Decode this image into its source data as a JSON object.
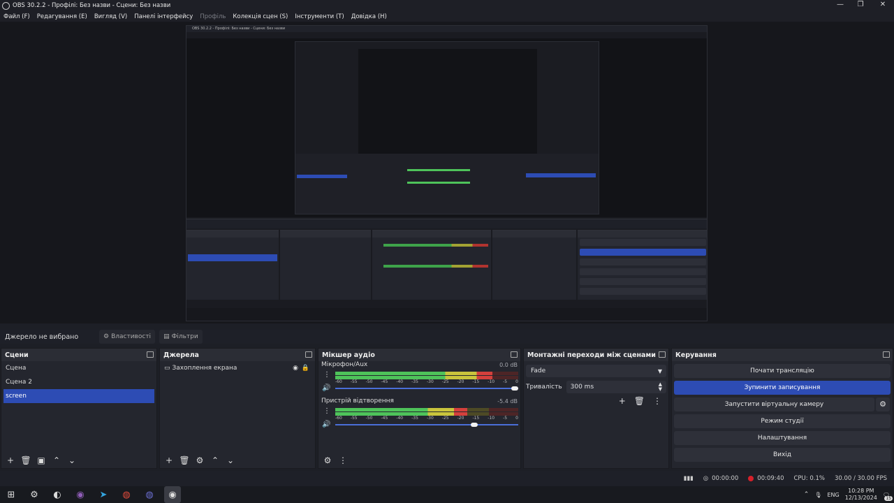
{
  "window": {
    "title": "OBS 30.2.2 - Профілі: Без назви - Сцени: Без назви",
    "controls": {
      "minimize": "—",
      "restore": "❐",
      "close": "✕"
    }
  },
  "menu": [
    {
      "label": "Файл (F)",
      "dim": false
    },
    {
      "label": "Редагування (E)",
      "dim": false
    },
    {
      "label": "Вигляд (V)",
      "dim": false
    },
    {
      "label": "Панелі інтерфейсу",
      "dim": false
    },
    {
      "label": "Профіль",
      "dim": true
    },
    {
      "label": "Колекція сцен (S)",
      "dim": false
    },
    {
      "label": "Інструменти (T)",
      "dim": false
    },
    {
      "label": "Довідка (H)",
      "dim": false
    }
  ],
  "source_toolbar": {
    "no_source": "Джерело не вибрано",
    "properties": "Властивості",
    "filters": "Фільтри"
  },
  "scenes": {
    "title": "Сцени",
    "items": [
      {
        "label": "Сцена",
        "selected": false
      },
      {
        "label": "Сцена 2",
        "selected": false
      },
      {
        "label": "screen",
        "selected": true
      }
    ],
    "footer": [
      "+",
      "🗑",
      "▣",
      "⌃",
      "⌄"
    ]
  },
  "sources": {
    "title": "Джерела",
    "items": [
      {
        "label": "Захоплення екрана"
      }
    ],
    "footer": [
      "+",
      "🗑",
      "⚙",
      "⌃",
      "⌄"
    ]
  },
  "mixer": {
    "title": "Мікшер аудіо",
    "ticks": [
      "-60",
      "-55",
      "-50",
      "-45",
      "-40",
      "-35",
      "-30",
      "-25",
      "-20",
      "-15",
      "-10",
      "-5",
      "0"
    ],
    "channels": [
      {
        "name": "Мікрофон/Aux",
        "db": "0.0 dB",
        "level": 0.86,
        "volume": 0.98
      },
      {
        "name": "Пристрій відтворення",
        "db": "-5.4 dB",
        "level": 0.72,
        "volume": 0.76
      }
    ],
    "footer": [
      "⚙",
      "⋮"
    ]
  },
  "transitions": {
    "title": "Монтажні переходи між сценами",
    "selected": "Fade",
    "duration_label": "Тривалість",
    "duration_value": "300 ms",
    "buttons": [
      "+",
      "🗑",
      "⋮"
    ]
  },
  "controls": {
    "title": "Керування",
    "buttons": [
      {
        "label": "Почати трансляцію",
        "active": false
      },
      {
        "label": "Зупинити записування",
        "active": true
      },
      {
        "label": "Запустити віртуальну камеру",
        "active": false
      },
      {
        "label": "Режим студії",
        "active": false
      },
      {
        "label": "Налаштування",
        "active": false
      },
      {
        "label": "Вихід",
        "active": false
      }
    ]
  },
  "status": {
    "stream_time": "00:00:00",
    "rec_time": "00:09:40",
    "cpu": "CPU: 0.1%",
    "fps": "30.00 / 30.00 FPS"
  },
  "taskbar": {
    "lang": "ENG",
    "time": "10:28 PM",
    "date": "12/13/2024",
    "notif": "15"
  },
  "colors": {
    "accent": "#2d4cb4",
    "record": "#d6202a",
    "meter_green": "#4ec35a",
    "meter_yellow": "#c9c43c",
    "meter_red": "#d4403c"
  }
}
